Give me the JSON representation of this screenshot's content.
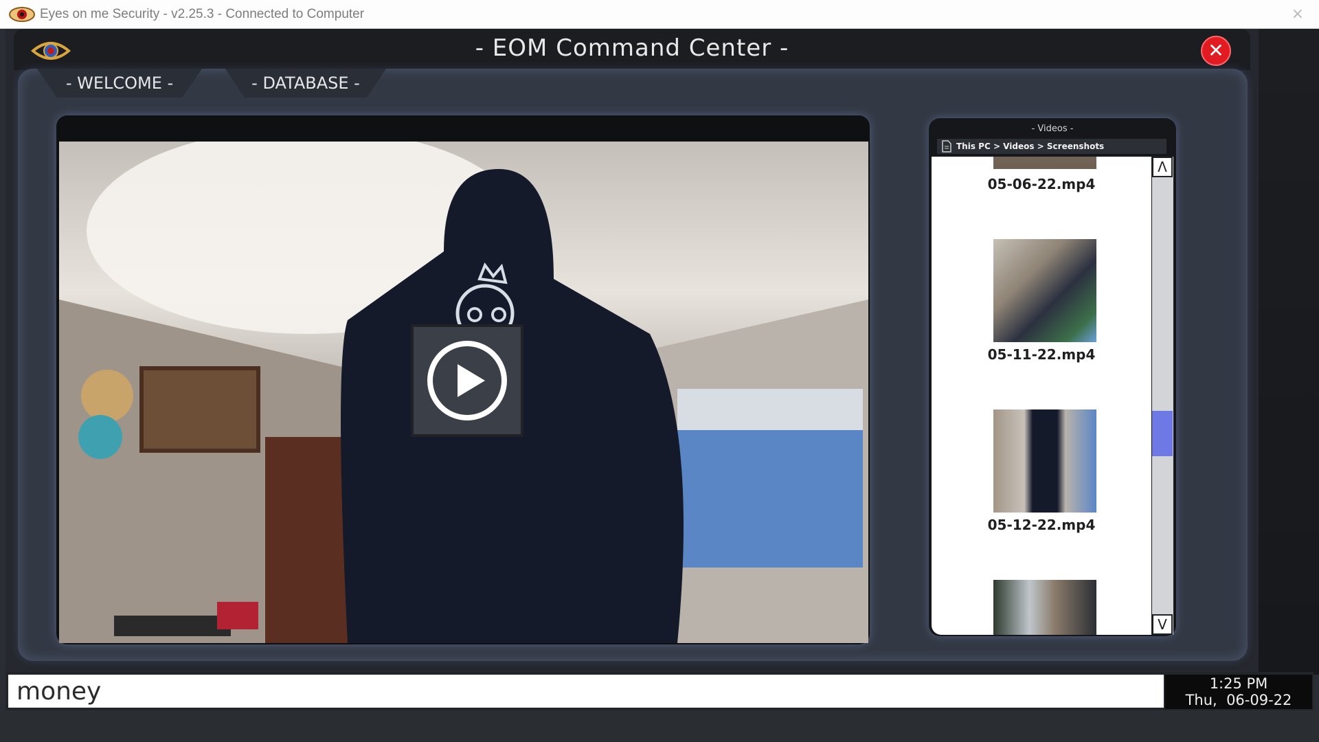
{
  "os_window": {
    "title": "Eyes on me Security - v2.25.3 - Connected to Computer",
    "close": "×"
  },
  "app": {
    "title": "- EOM Command Center -",
    "close": "✕"
  },
  "tabs": [
    {
      "label": "- WELCOME -"
    },
    {
      "label": "- DATABASE -"
    }
  ],
  "videos": {
    "title": "- Videos -",
    "breadcrumb": "This PC > Videos > Screenshots",
    "files": [
      {
        "name": "05-06-22.mp4"
      },
      {
        "name": "05-11-22.mp4"
      },
      {
        "name": "05-12-22.mp4"
      }
    ],
    "scroll_up": "Λ",
    "scroll_down": "V"
  },
  "input": {
    "value": "money"
  },
  "clock": {
    "time": "1:25 PM",
    "date": "Thu,  06-09-22"
  },
  "colors": {
    "close_red": "#e21b23",
    "scroll_thumb": "#6f79e6",
    "panel_bg": "#333944"
  }
}
